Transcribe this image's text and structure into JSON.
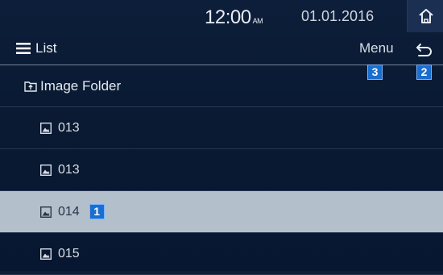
{
  "status": {
    "time": "12:00",
    "ampm": "AM",
    "date": "01.01.2016"
  },
  "toolbar": {
    "list_label": "List",
    "menu_label": "Menu"
  },
  "badges": {
    "selected_item": "1",
    "back": "2",
    "menu": "3"
  },
  "folder": {
    "name": "Image Folder"
  },
  "files": [
    {
      "name": "013",
      "selected": false
    },
    {
      "name": "013",
      "selected": false
    },
    {
      "name": "014",
      "selected": true
    },
    {
      "name": "015",
      "selected": false
    }
  ],
  "colors": {
    "background": "#0a1a33",
    "selected_row": "#b4bfcc",
    "badge": "#1a6ecf"
  },
  "icons": {
    "home": "home-icon",
    "list": "hamburger-icon",
    "back": "back-arrow-icon",
    "folder": "folder-up-icon",
    "image": "image-icon"
  }
}
